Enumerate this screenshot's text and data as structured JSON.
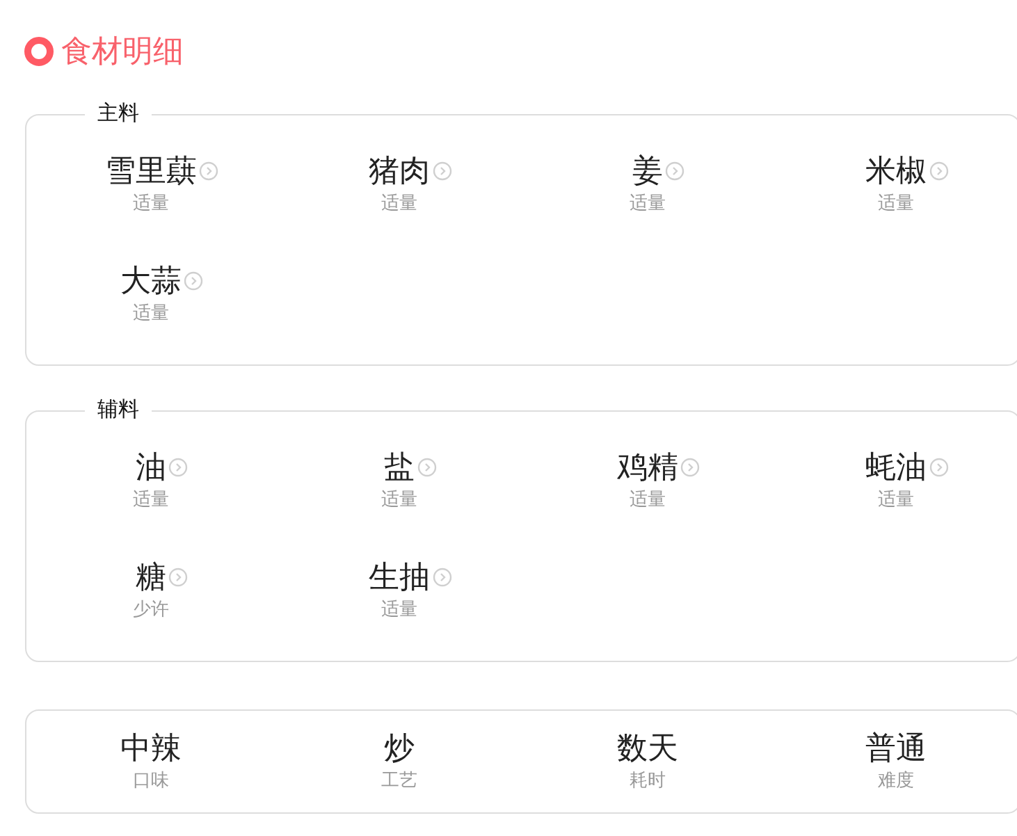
{
  "title": "食材明细",
  "sections": [
    {
      "label": "主料",
      "items": [
        {
          "name": "雪里蕻",
          "amount": "适量"
        },
        {
          "name": "猪肉",
          "amount": "适量"
        },
        {
          "name": "姜",
          "amount": "适量"
        },
        {
          "name": "米椒",
          "amount": "适量"
        },
        {
          "name": "大蒜",
          "amount": "适量"
        }
      ]
    },
    {
      "label": "辅料",
      "items": [
        {
          "name": "油",
          "amount": "适量"
        },
        {
          "name": "盐",
          "amount": "适量"
        },
        {
          "name": "鸡精",
          "amount": "适量"
        },
        {
          "name": "蚝油",
          "amount": "适量"
        },
        {
          "name": "糖",
          "amount": "少许"
        },
        {
          "name": "生抽",
          "amount": "适量"
        }
      ]
    }
  ],
  "stats": [
    {
      "value": "中辣",
      "label": "口味"
    },
    {
      "value": "炒",
      "label": "工艺"
    },
    {
      "value": "数天",
      "label": "耗时"
    },
    {
      "value": "普通",
      "label": "难度"
    }
  ]
}
